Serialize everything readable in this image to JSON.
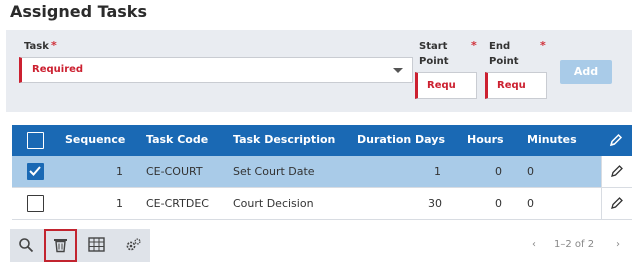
{
  "header": {
    "title": "Assigned Tasks"
  },
  "form": {
    "task_label": "Task",
    "task_value": "Required",
    "start_label_1": "Start",
    "start_label_2": "Point",
    "start_value": "Requ",
    "end_label_1": "End",
    "end_label_2": "Point",
    "end_value": "Requ",
    "required_mark": "*",
    "add_label": "Add"
  },
  "grid": {
    "columns": [
      "Sequence",
      "Task Code",
      "Task Description",
      "Duration Days",
      "Hours",
      "Minutes"
    ],
    "rows": [
      {
        "selected": true,
        "sequence": "1",
        "task_code": "CE-COURT",
        "description": "Set Court Date",
        "duration": "1",
        "hours": "0",
        "minutes": "0"
      },
      {
        "selected": false,
        "sequence": "1",
        "task_code": "CE-CRTDEC",
        "description": "Court Decision",
        "duration": "30",
        "hours": "0",
        "minutes": "0"
      }
    ]
  },
  "toolbar": {
    "icons": [
      "search-icon",
      "trash-icon",
      "table-icon",
      "settings-icon"
    ],
    "active": "trash-icon"
  },
  "pager": {
    "prev": "‹",
    "text": "1–2 of 2",
    "next": "›"
  },
  "colors": {
    "header": "#1a69b4",
    "selected_row": "#a9cbe8",
    "required": "#cc2030",
    "add_button": "#a9cbe8"
  }
}
